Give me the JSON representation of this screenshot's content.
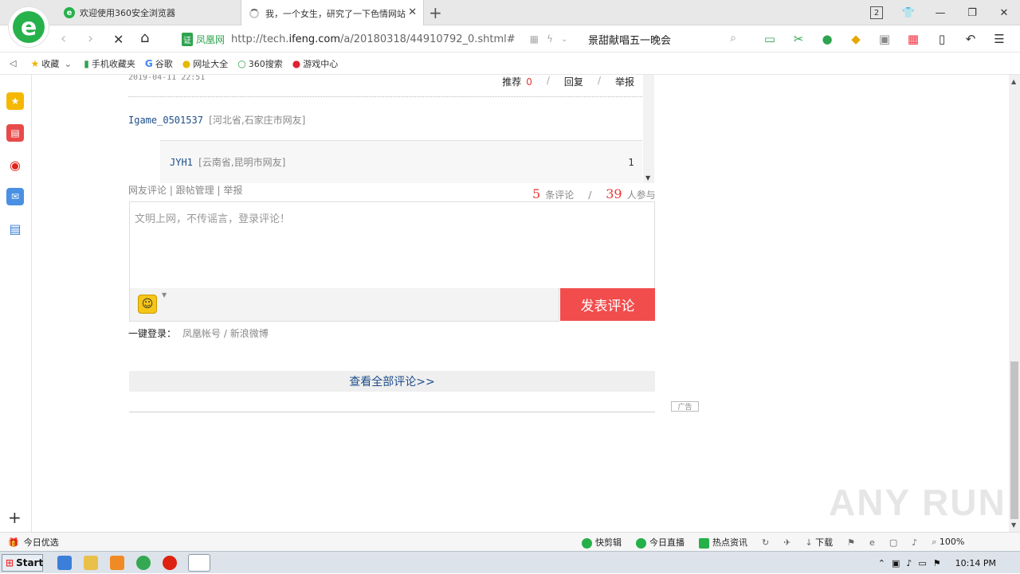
{
  "browser": {
    "tabs": [
      {
        "title": "欢迎使用360安全浏览器",
        "active": false
      },
      {
        "title": "我，一个女生，研究了一下色情网站",
        "active": true
      }
    ],
    "tab_count": "2",
    "cert_label": "证",
    "cert_name": "凤凰网",
    "url_host_prefix": "http://tech.",
    "url_host": "ifeng.com",
    "url_path": "/a/20180318/44910792_0.shtml#",
    "search_text": "景甜献唱五一晚会",
    "bookmarks": [
      "收藏",
      "手机收藏夹",
      "谷歌",
      "网址大全",
      "360搜索",
      "游戏中心"
    ]
  },
  "comment": {
    "date": "2019-04-11 22:51",
    "recommend_label": "推荐",
    "recommend_count": "0",
    "reply_label": "回复",
    "report_label": "举报",
    "user": "Igame_0501537",
    "user_location": "[河北省,石家庄市网友]",
    "reply_user": "JYH1",
    "reply_location": "[云南省,昆明市网友]",
    "reply_count": "1"
  },
  "comment_form": {
    "links": "网友评论 | 跟帖管理 | 举报",
    "total_comments": "5",
    "comments_unit": "条评论",
    "participants": "39",
    "participants_unit": "人参与",
    "placeholder": "文明上网，不传谣言，登录评论！",
    "submit_label": "发表评论",
    "login_label": "一键登录：",
    "login_options": "凤凰帐号 / 新浪微博",
    "view_all": "查看全部评论>>",
    "ad_tag": "广告"
  },
  "statusbar": {
    "left_label": "今日优选",
    "items": [
      "快剪辑",
      "今日直播",
      "热点资讯"
    ],
    "download_label": "下载",
    "zoom": "100%"
  },
  "taskbar": {
    "start_label": "Start",
    "clock": "10:14 PM"
  },
  "watermark": "ANY RUN",
  "colors": {
    "accent_green": "#27b14b",
    "submit_red": "#f24d4d",
    "count_red": "#e33333",
    "link_blue": "#1d4d8a"
  }
}
